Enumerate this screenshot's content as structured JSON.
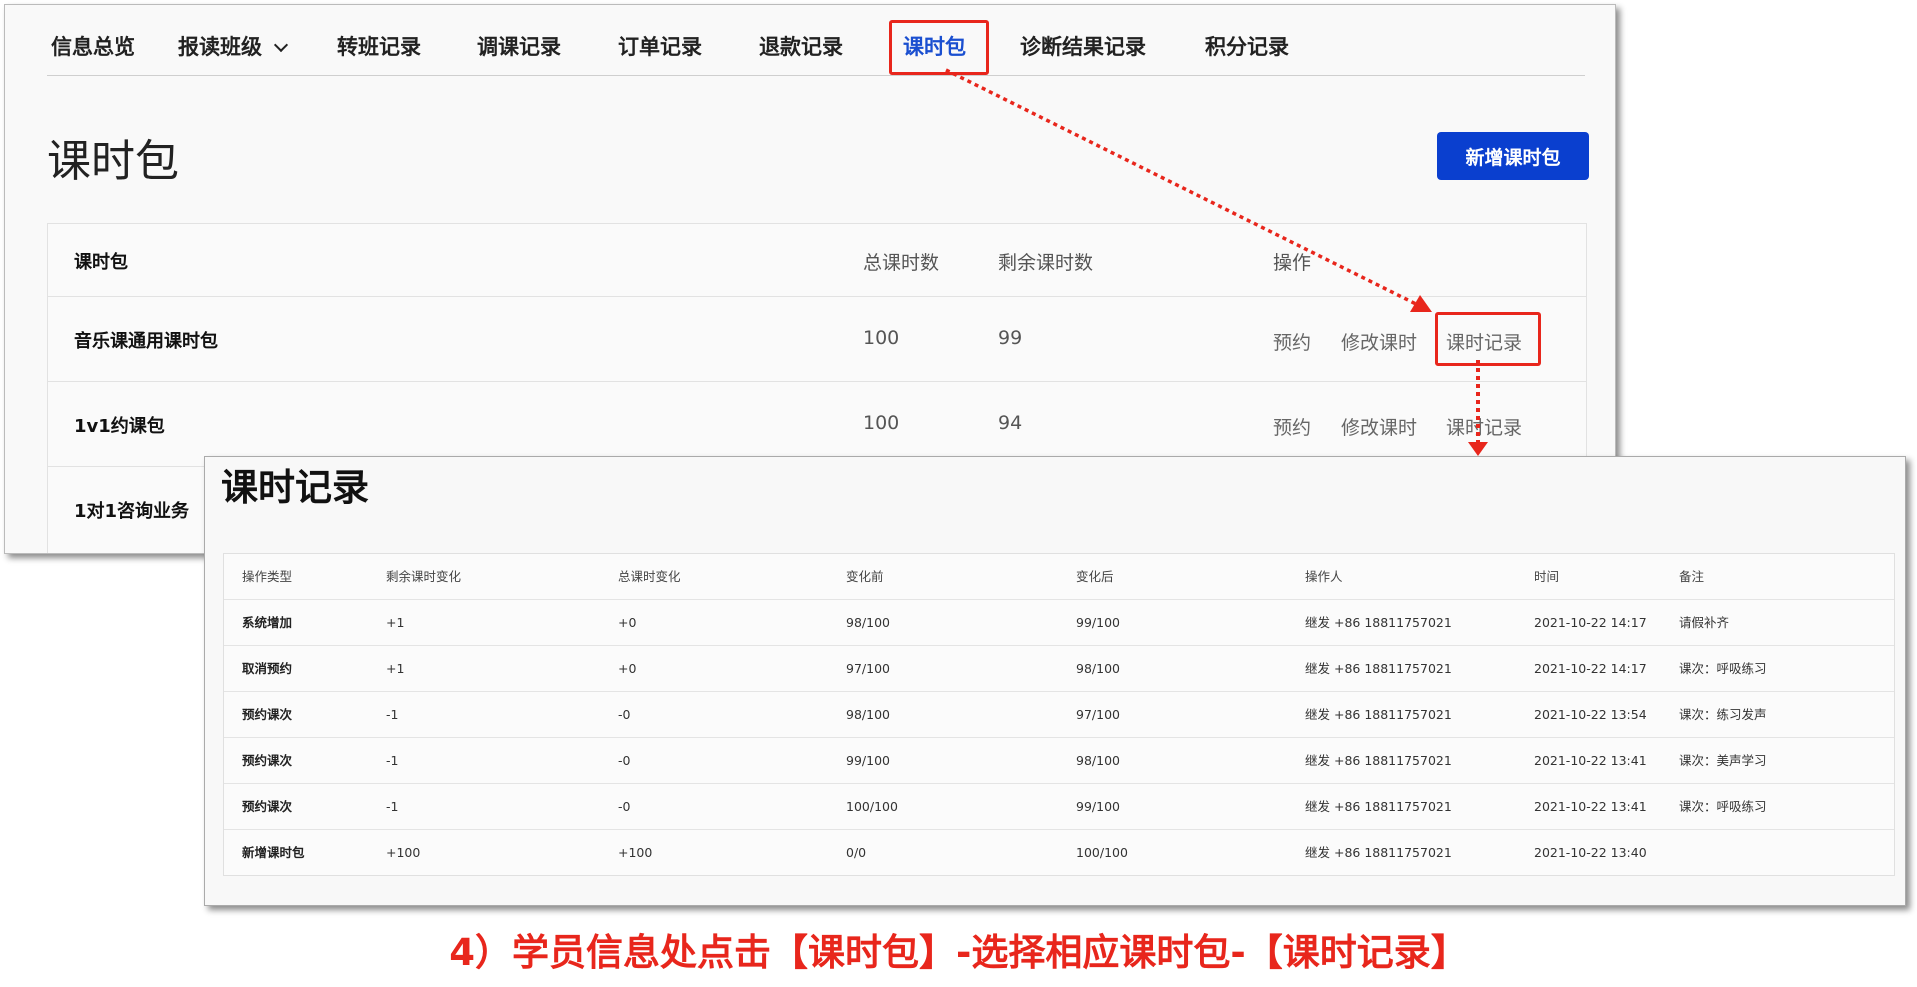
{
  "nav": {
    "tabs": [
      {
        "label": "信息总览"
      },
      {
        "label": "报读班级"
      },
      {
        "label": "转班记录"
      },
      {
        "label": "调课记录"
      },
      {
        "label": "订单记录"
      },
      {
        "label": "退款记录"
      },
      {
        "label": "课时包",
        "active": true
      },
      {
        "label": "诊断结果记录"
      },
      {
        "label": "积分记录"
      }
    ]
  },
  "packages": {
    "title": "课时包",
    "new_button": "新增课时包",
    "headers": [
      "课时包",
      "总课时数",
      "剩余课时数",
      "操作"
    ],
    "rows": [
      {
        "name": "音乐课通用课时包",
        "total": "100",
        "remaining": "99",
        "actions": [
          "预约",
          "修改课时",
          "课时记录"
        ]
      },
      {
        "name": "1v1约课包",
        "total": "100",
        "remaining": "94",
        "actions": [
          "预约",
          "修改课时",
          "课时记录"
        ]
      },
      {
        "name": "1对1咨询业务"
      }
    ]
  },
  "records": {
    "title": "课时记录",
    "headers": [
      "操作类型",
      "剩余课时变化",
      "总课时变化",
      "变化前",
      "变化后",
      "操作人",
      "时间",
      "备注"
    ],
    "rows": [
      [
        "系统增加",
        "+1",
        "+0",
        "98/100",
        "99/100",
        "继发 +86 18811757021",
        "2021-10-22 14:17",
        "请假补齐"
      ],
      [
        "取消预约",
        "+1",
        "+0",
        "97/100",
        "98/100",
        "继发 +86 18811757021",
        "2021-10-22 14:17",
        "课次：呼吸练习"
      ],
      [
        "预约课次",
        "-1",
        "-0",
        "98/100",
        "97/100",
        "继发 +86 18811757021",
        "2021-10-22 13:54",
        "课次：练习发声"
      ],
      [
        "预约课次",
        "-1",
        "-0",
        "99/100",
        "98/100",
        "继发 +86 18811757021",
        "2021-10-22 13:41",
        "课次：美声学习"
      ],
      [
        "预约课次",
        "-1",
        "-0",
        "100/100",
        "99/100",
        "继发 +86 18811757021",
        "2021-10-22 13:41",
        "课次：呼吸练习"
      ],
      [
        "新增课时包",
        "+100",
        "+100",
        "0/0",
        "100/100",
        "继发 +86 18811757021",
        "2021-10-22 13:40",
        ""
      ]
    ]
  },
  "caption": "4）学员信息处点击【课时包】-选择相应课时包-【课时记录】",
  "colors": {
    "accent": "#1a4fd0",
    "button": "#0a3fcf",
    "highlight": "#e8261c"
  }
}
